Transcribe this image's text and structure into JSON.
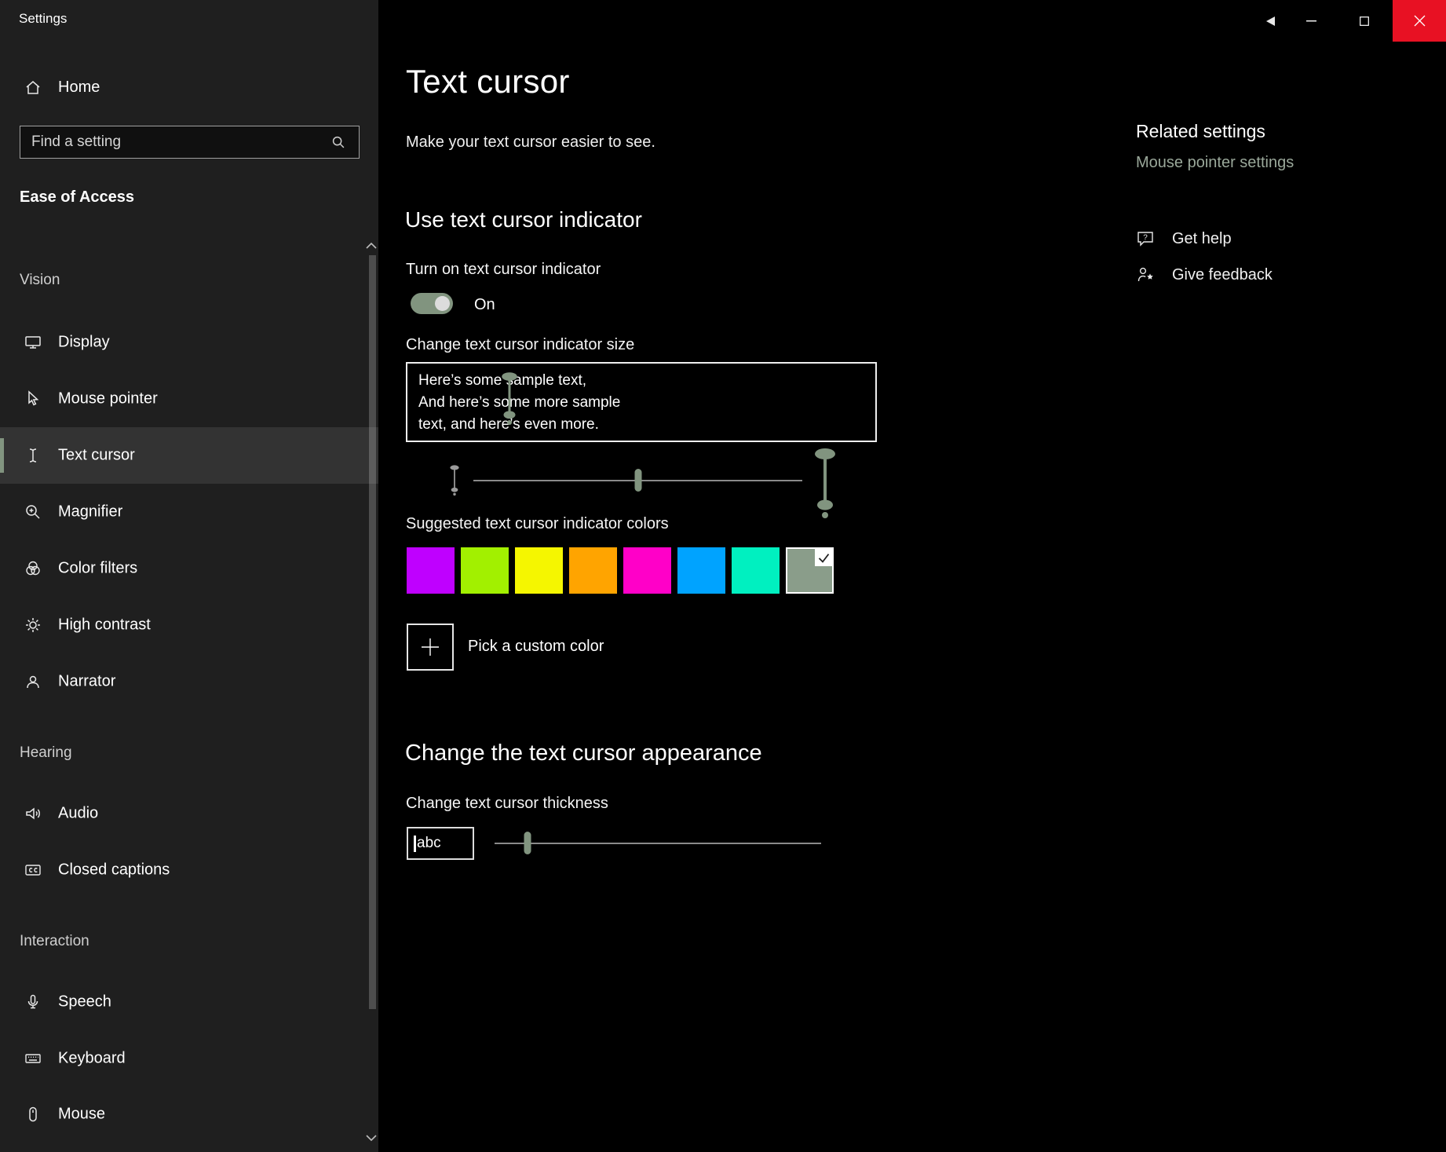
{
  "window": {
    "app_title": "Settings",
    "controls": {
      "back": "back-arrow",
      "minimize": "minimize",
      "maximize": "maximize",
      "close": "close"
    }
  },
  "sidebar": {
    "home_label": "Home",
    "search_placeholder": "Find a setting",
    "section_title": "Ease of Access",
    "selected_item": "Text cursor",
    "groups": [
      {
        "label": "Vision",
        "items": [
          {
            "label": "Display"
          },
          {
            "label": "Mouse pointer"
          },
          {
            "label": "Text cursor"
          },
          {
            "label": "Magnifier"
          },
          {
            "label": "Color filters"
          },
          {
            "label": "High contrast"
          },
          {
            "label": "Narrator"
          }
        ]
      },
      {
        "label": "Hearing",
        "items": [
          {
            "label": "Audio"
          },
          {
            "label": "Closed captions"
          }
        ]
      },
      {
        "label": "Interaction",
        "items": [
          {
            "label": "Speech"
          },
          {
            "label": "Keyboard"
          },
          {
            "label": "Mouse"
          }
        ]
      }
    ]
  },
  "main": {
    "title": "Text cursor",
    "subtitle": "Make your text cursor easier to see.",
    "indicator": {
      "heading": "Use text cursor indicator",
      "toggle_label": "Turn on text cursor indicator",
      "toggle_state": "On",
      "toggle_on": true,
      "size_label": "Change text cursor indicator size",
      "sample_lines": [
        "Here’s some sample text,",
        "And here’s some more sample",
        "text, and here’s even more."
      ],
      "size_slider_pct": 50,
      "colors_label": "Suggested text cursor indicator colors",
      "swatches": [
        "#bf00ff",
        "#a2f000",
        "#f5f600",
        "#ffa400",
        "#ff00c8",
        "#00a3ff",
        "#00f0c0",
        "#8a9d8a"
      ],
      "selected_swatch_index": 7,
      "custom_color_label": "Pick a custom color"
    },
    "appearance": {
      "heading": "Change the text cursor appearance",
      "thickness_label": "Change text cursor thickness",
      "preview_text": "abc",
      "thickness_slider_pct": 10
    }
  },
  "related": {
    "heading": "Related settings",
    "link_label": "Mouse pointer settings",
    "help_label": "Get help",
    "feedback_label": "Give feedback"
  },
  "colors": {
    "accent": "#81947f",
    "close_button": "#e81123",
    "sidebar_bg": "#1f1f1f",
    "content_bg": "#000000"
  }
}
